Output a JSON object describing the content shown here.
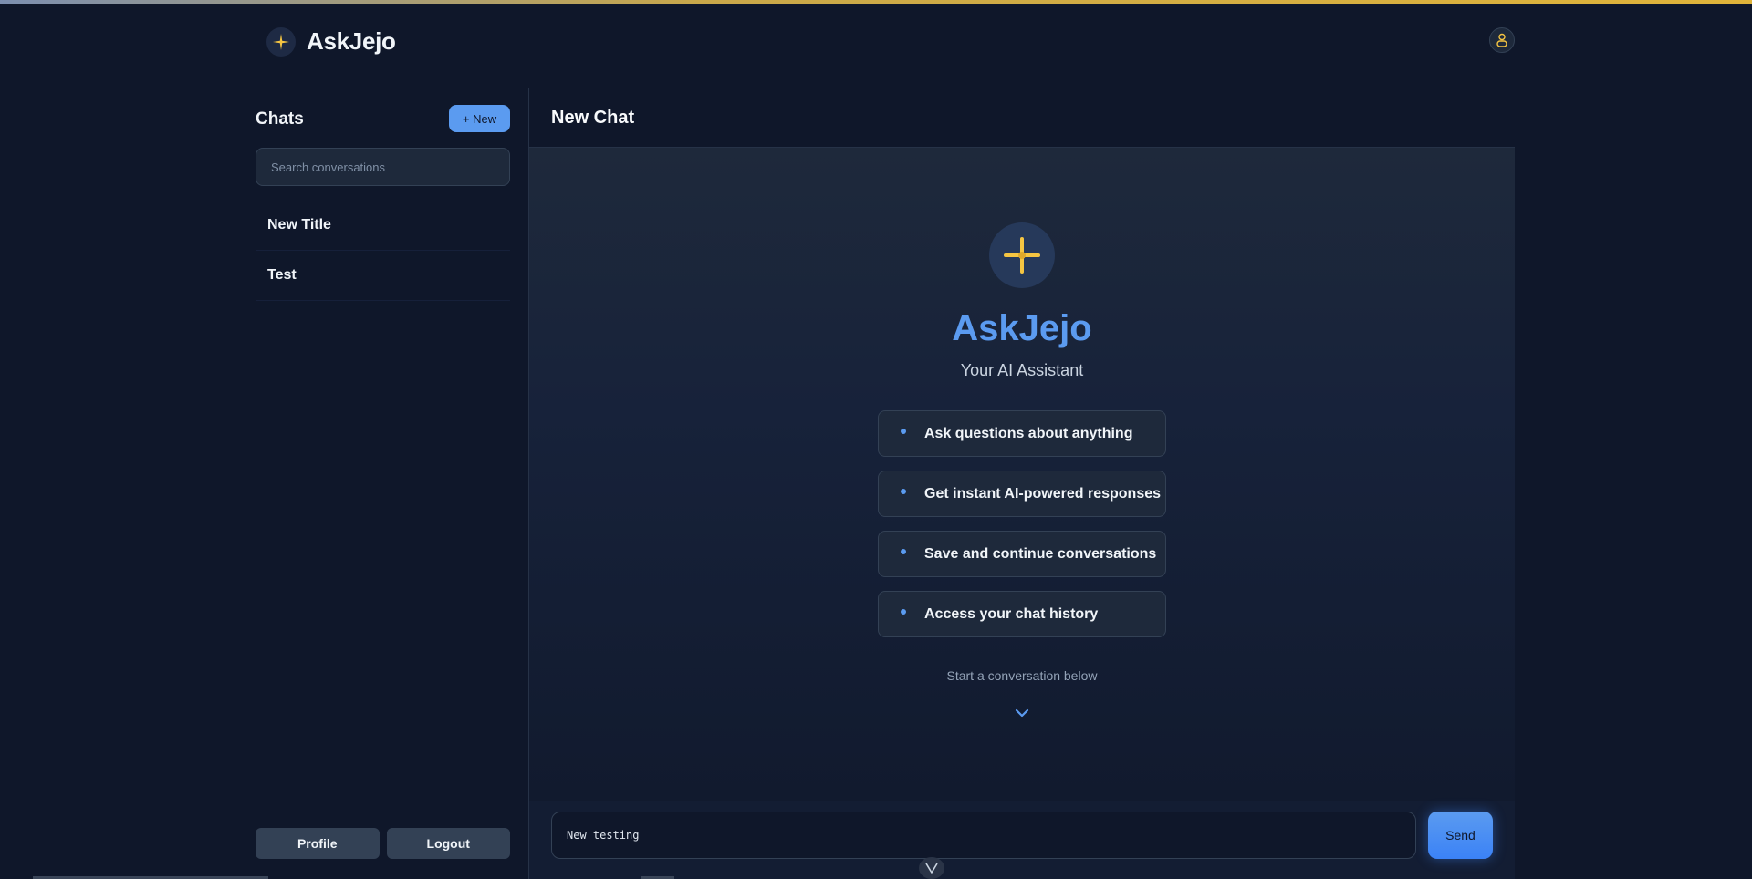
{
  "colors": {
    "background": "#0f172a",
    "accent_blue": "#5b9bf0",
    "accent_gold": "#f5c542",
    "panel": "#1e293b"
  },
  "header": {
    "logo_icon": "sparkle-icon",
    "app_name": "AskJejo",
    "user_icon": "user-icon"
  },
  "sidebar": {
    "title": "Chats",
    "new_button": "+ New",
    "search_placeholder": "Search conversations",
    "chats": [
      {
        "title": "New Title"
      },
      {
        "title": "Test"
      }
    ],
    "profile_button": "Profile",
    "logout_button": "Logout"
  },
  "main": {
    "title": "New Chat",
    "hero_icon": "sparkle-icon",
    "hero_title": "AskJejo",
    "hero_subtitle": "Your AI Assistant",
    "features": [
      "Ask questions about anything",
      "Get instant AI-powered responses",
      "Save and continue conversations",
      "Access your chat history"
    ],
    "hint": "Start a conversation below",
    "hint_icon": "chevron-down-icon"
  },
  "composer": {
    "input_value": "New testing",
    "send_button": "Send"
  },
  "floating_badge": {
    "icon": "vue-logo-icon"
  }
}
